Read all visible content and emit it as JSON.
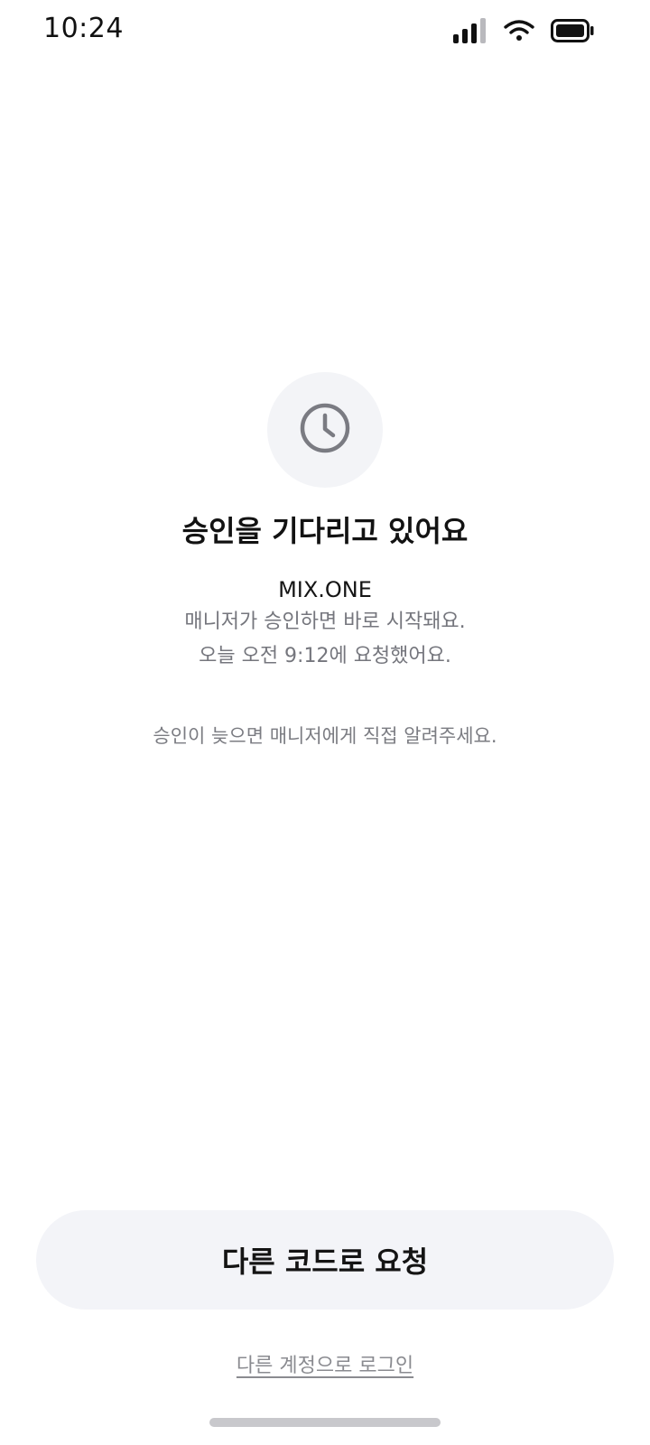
{
  "status_bar": {
    "time": "10:24",
    "icons": [
      "signal-icon",
      "wifi-icon",
      "battery-icon"
    ]
  },
  "main": {
    "icon": "clock-icon",
    "title": "승인을 기다리고 있어요",
    "company": "MIX.ONE",
    "description_line1": "매니저가 승인하면 바로 시작돼요.",
    "description_line2": "오늘 오전 9:12에 요청했어요.",
    "note": "승인이 늦으면 매니저에게 직접 알려주세요."
  },
  "actions": {
    "primary_label": "다른 코드로 요청",
    "secondary_label": "다른 계정으로 로그인"
  },
  "colors": {
    "background": "#ffffff",
    "circle_bg": "#f3f4f7",
    "icon_gray": "#7a7b82",
    "button_bg": "#f3f4f8",
    "text_primary": "#121212",
    "text_secondary": "#75767d"
  }
}
